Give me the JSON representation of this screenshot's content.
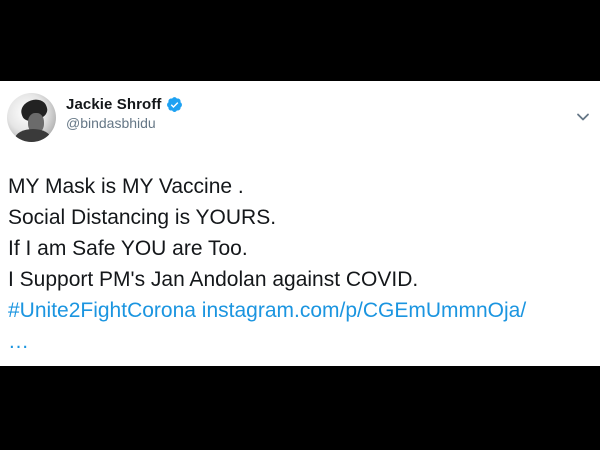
{
  "colors": {
    "background": "#000000",
    "card": "#ffffff",
    "text": "#14171a",
    "secondary_text": "#657786",
    "link": "#1b95e0",
    "verified_badge": "#1da1f2"
  },
  "tweet": {
    "author": {
      "display_name": "Jackie Shroff",
      "handle": "@bindasbhidu",
      "verified": true,
      "verified_icon": "verified-badge-icon",
      "avatar_icon": "avatar"
    },
    "menu_icon": "chevron-down-icon",
    "lines": [
      "MY Mask is MY Vaccine .",
      "Social Distancing is YOURS.",
      "If I am Safe YOU are Too.",
      "I Support PM's Jan Andolan against COVID."
    ],
    "hashtag": "#Unite2FightCorona",
    "url": "instagram.com/p/CGEmUmmnOja/",
    "truncation": "…"
  }
}
